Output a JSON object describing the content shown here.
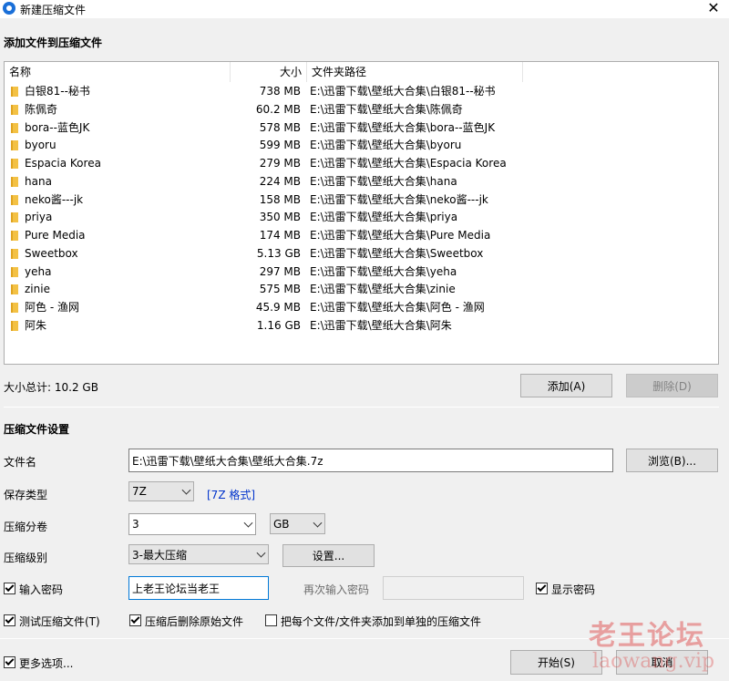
{
  "window": {
    "title": "新建压缩文件",
    "close_icon": "close-icon"
  },
  "add_section": {
    "title": "添加文件到压缩文件",
    "columns": [
      "名称",
      "大小",
      "文件夹路径"
    ],
    "rows": [
      {
        "name": "白银81--秘书",
        "size": "738 MB",
        "path": "E:\\迅雷下载\\壁纸大合集\\白银81--秘书"
      },
      {
        "name": "陈佩奇",
        "size": "60.2 MB",
        "path": "E:\\迅雷下载\\壁纸大合集\\陈佩奇"
      },
      {
        "name": "bora--蓝色JK",
        "size": "578 MB",
        "path": "E:\\迅雷下载\\壁纸大合集\\bora--蓝色JK"
      },
      {
        "name": "byoru",
        "size": "599 MB",
        "path": "E:\\迅雷下载\\壁纸大合集\\byoru"
      },
      {
        "name": "Espacia Korea",
        "size": "279 MB",
        "path": "E:\\迅雷下载\\壁纸大合集\\Espacia Korea"
      },
      {
        "name": "hana",
        "size": "224 MB",
        "path": "E:\\迅雷下载\\壁纸大合集\\hana"
      },
      {
        "name": "neko酱---jk",
        "size": "158 MB",
        "path": "E:\\迅雷下载\\壁纸大合集\\neko酱---jk"
      },
      {
        "name": "priya",
        "size": "350 MB",
        "path": "E:\\迅雷下载\\壁纸大合集\\priya"
      },
      {
        "name": "Pure Media",
        "size": "174 MB",
        "path": "E:\\迅雷下载\\壁纸大合集\\Pure Media"
      },
      {
        "name": "Sweetbox",
        "size": "5.13 GB",
        "path": "E:\\迅雷下载\\壁纸大合集\\Sweetbox"
      },
      {
        "name": "yeha",
        "size": "297 MB",
        "path": "E:\\迅雷下载\\壁纸大合集\\yeha"
      },
      {
        "name": "zinie",
        "size": "575 MB",
        "path": "E:\\迅雷下载\\壁纸大合集\\zinie"
      },
      {
        "name": "阿色 - 渔网",
        "size": "45.9 MB",
        "path": "E:\\迅雷下载\\壁纸大合集\\阿色 - 渔网"
      },
      {
        "name": "阿朱",
        "size": "1.16 GB",
        "path": "E:\\迅雷下载\\壁纸大合集\\阿朱"
      }
    ],
    "total_label": "大小总计: 10.2 GB",
    "add_button": "添加(A)",
    "delete_button": "删除(D)"
  },
  "settings": {
    "title": "压缩文件设置",
    "filename_label": "文件名",
    "filename_value": "E:\\迅雷下载\\壁纸大合集\\壁纸大合集.7z",
    "browse_button": "浏览(B)...",
    "type_label": "保存类型",
    "type_value": "7Z",
    "type_format_link": "[7Z 格式]",
    "split_label": "压缩分卷",
    "split_value": "3",
    "split_unit": "GB",
    "level_label": "压缩级别",
    "level_value": "3-最大压缩",
    "settings_button": "设置...",
    "password_label": "输入密码",
    "password_checked": true,
    "password_value": "上老王论坛当老王",
    "reenter_label": "再次输入密码",
    "reenter_value": "",
    "show_password_label": "显示密码",
    "show_password_checked": true,
    "test_label": "测试压缩文件(T)",
    "test_checked": true,
    "delete_after_label": "压缩后删除原始文件",
    "delete_after_checked": true,
    "separate_label": "把每个文件/文件夹添加到单独的压缩文件",
    "separate_checked": false
  },
  "footer": {
    "more_options_label": "更多选项...",
    "more_options_checked": true,
    "start_button": "开始(S)",
    "cancel_button": "取消"
  },
  "watermark": {
    "line1": "老王论坛",
    "line2": "laowang.vip"
  }
}
